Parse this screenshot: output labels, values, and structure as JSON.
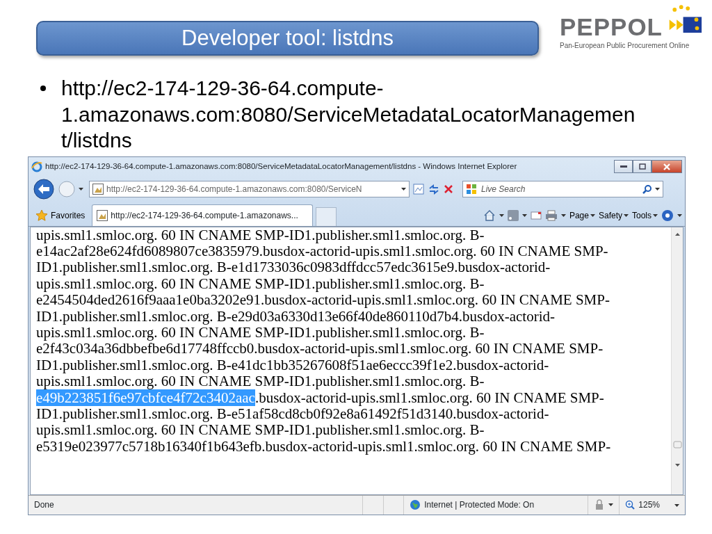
{
  "slide": {
    "title": "Developer tool: listdns",
    "logo": {
      "name": "PEPPOL",
      "tagline": "Pan-European Public Procurement Online"
    },
    "bullet": {
      "lines": [
        "http://ec2-174-129-36-64.compute-",
        "1.amazonaws.com:8080/ServiceMetadataLocatorManagemen",
        "t/listdns"
      ]
    }
  },
  "browser": {
    "window": {
      "title": "http://ec2-174-129-36-64.compute-1.amazonaws.com:8080/ServiceMetadataLocatorManagement/listdns - Windows Internet Explorer"
    },
    "address": {
      "value": "http://ec2-174-129-36-64.compute-1.amazonaws.com:8080/ServiceN"
    },
    "search": {
      "placeholder": "Live Search"
    },
    "favorites": "Favorites",
    "tab": {
      "label": "http://ec2-174-129-36-64.compute-1.amazonaws...",
      "selected": true
    },
    "menus": [
      "Page",
      "Safety",
      "Tools"
    ],
    "content": [
      {
        "parts": [
          {
            "text": "upis.sml1.smloc.org. 60 IN CNAME SMP-ID1.publisher.sml1.smloc.org. B-",
            "selected": false
          }
        ]
      },
      {
        "parts": [
          {
            "text": "e14ac2af28e624fd6089807ce3835979.busdox-actorid-upis.sml1.smloc.org. 60 IN CNAME SMP-",
            "selected": false
          }
        ]
      },
      {
        "parts": [
          {
            "text": "ID1.publisher.sml1.smloc.org. B-e1d1733036c0983dffdcc57edc3615e9.busdox-actorid-",
            "selected": false
          }
        ]
      },
      {
        "parts": [
          {
            "text": "upis.sml1.smloc.org. 60 IN CNAME SMP-ID1.publisher.sml1.smloc.org. B-",
            "selected": false
          }
        ]
      },
      {
        "parts": [
          {
            "text": "e2454504ded2616f9aaa1e0ba3202e91.busdox-actorid-upis.sml1.smloc.org. 60 IN CNAME SMP-",
            "selected": false
          }
        ]
      },
      {
        "parts": [
          {
            "text": "ID1.publisher.sml1.smloc.org. B-e29d03a6330d13e66f40de860110d7b4.busdox-actorid-",
            "selected": false
          }
        ]
      },
      {
        "parts": [
          {
            "text": "upis.sml1.smloc.org. 60 IN CNAME SMP-ID1.publisher.sml1.smloc.org. B-",
            "selected": false
          }
        ]
      },
      {
        "parts": [
          {
            "text": "e2f43c034a36dbbefbe6d17748ffccb0.busdox-actorid-upis.sml1.smloc.org. 60 IN CNAME SMP-",
            "selected": false
          }
        ]
      },
      {
        "parts": [
          {
            "text": "ID1.publisher.sml1.smloc.org. B-e41dc1bb35267608f51ae6eccc39f1e2.busdox-actorid-",
            "selected": false
          }
        ]
      },
      {
        "parts": [
          {
            "text": "upis.sml1.smloc.org. 60 IN CNAME SMP-ID1.publisher.sml1.smloc.org. B-",
            "selected": false
          }
        ]
      },
      {
        "parts": [
          {
            "text": "e49b223851f6e97cbfce4f72c3402aac",
            "selected": true
          },
          {
            "text": ".busdox-actorid-upis.sml1.smloc.org. 60 IN CNAME SMP-",
            "selected": false
          }
        ]
      },
      {
        "parts": [
          {
            "text": "ID1.publisher.sml1.smloc.org. B-e51af58cd8cb0f92e8a61492f51d3140.busdox-actorid-",
            "selected": false
          }
        ]
      },
      {
        "parts": [
          {
            "text": "upis.sml1.smloc.org. 60 IN CNAME SMP-ID1.publisher.sml1.smloc.org. B-",
            "selected": false
          }
        ]
      },
      {
        "parts": [
          {
            "text": "e5319e023977c5718b16340f1b643efb.busdox-actorid-upis.sml1.smloc.org. 60 IN CNAME SMP-",
            "selected": false
          }
        ]
      }
    ],
    "status_bar": {
      "status": "Done",
      "zone": "Internet | Protected Mode: On",
      "zoom": "125%"
    }
  }
}
